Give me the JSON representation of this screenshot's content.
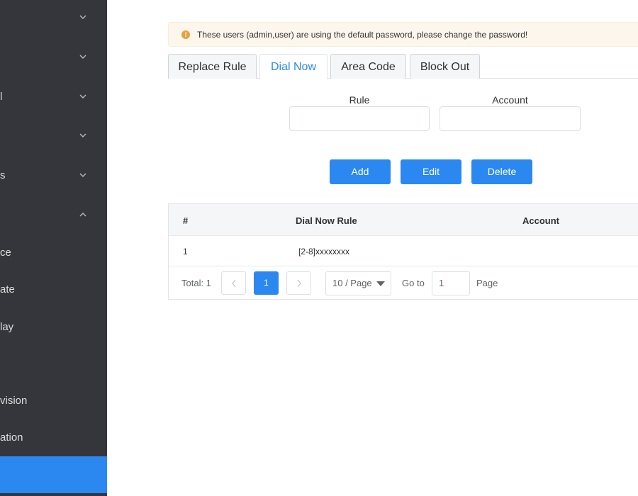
{
  "sidebar": {
    "groups": [
      {
        "label": "",
        "state": "collapsed"
      },
      {
        "label": "",
        "state": "collapsed"
      },
      {
        "label": "l",
        "state": "collapsed"
      },
      {
        "label": "",
        "state": "collapsed"
      },
      {
        "label": "s",
        "state": "collapsed"
      },
      {
        "label": "",
        "state": "expanded"
      }
    ],
    "subitems": [
      "ce",
      "ate",
      "lay",
      "",
      "vision",
      "ation",
      ""
    ]
  },
  "alert": {
    "text": "These users (admin,user) are using the default password, please change the password!",
    "icon": "warning-icon",
    "icon_glyph": "!"
  },
  "tabs": [
    {
      "label": "Replace Rule",
      "active": false
    },
    {
      "label": "Dial Now",
      "active": true
    },
    {
      "label": "Area Code",
      "active": false
    },
    {
      "label": "Block Out",
      "active": false
    }
  ],
  "form": {
    "rule_label": "Rule",
    "rule_value": "",
    "account_label": "Account",
    "account_value": ""
  },
  "buttons": {
    "add": "Add",
    "edit": "Edit",
    "delete": "Delete"
  },
  "table": {
    "headers": [
      "#",
      "Dial Now Rule",
      "Account"
    ],
    "rows": [
      {
        "index": "1",
        "rule": "[2-8]xxxxxxxx",
        "account": ""
      }
    ]
  },
  "pagination": {
    "total": "Total: 1",
    "prev": "<",
    "current": "1",
    "next": ">",
    "page_size": "10 / Page",
    "goto_label": "Go to",
    "goto_value": "1",
    "page_label": "Page"
  },
  "colors": {
    "accent": "#2b88f0",
    "sidebar_bg": "#35363b",
    "warning": "#e6a23c"
  }
}
